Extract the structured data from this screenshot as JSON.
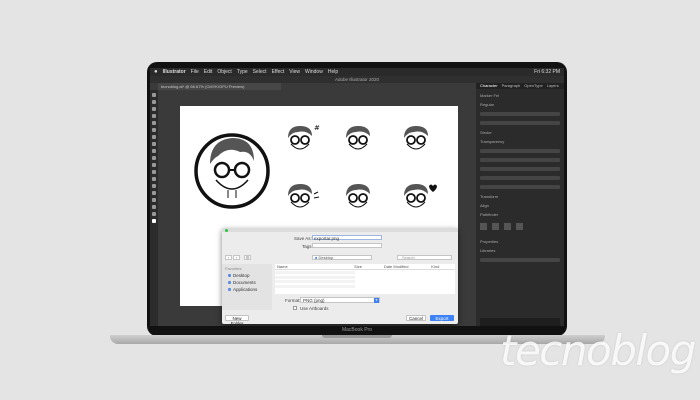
{
  "menubar": {
    "app": "Illustrator",
    "items": [
      "File",
      "Edit",
      "Object",
      "Type",
      "Select",
      "Effect",
      "View",
      "Window",
      "Help"
    ],
    "clock": "Fri 6:32 PM"
  },
  "window": {
    "title": "Adobe Illustrator 2020",
    "doc_tab": "tecnoblog.ai* @ 66.67% (CMYK/GPU Preview)"
  },
  "panel": {
    "tabs": [
      "Character",
      "Paragraph",
      "OpenType",
      "Layers"
    ],
    "font": "Marker Fel",
    "style": "Regular",
    "sections": [
      "Stroke",
      "Transparency",
      "Transform",
      "Align",
      "Pathfinder",
      "Properties",
      "Libraries"
    ]
  },
  "dialog": {
    "save_as_label": "Save As:",
    "save_as_value": "exportar.png",
    "tags_label": "Tags:",
    "location": "Desktop",
    "search_placeholder": "Search",
    "sidebar_heading": "Favorites",
    "sidebar_items": [
      "Desktop",
      "Documents",
      "Applications"
    ],
    "columns": [
      "Name",
      "Size",
      "Date Modified",
      "Kind"
    ],
    "format_label": "Format:",
    "format_value": "PNG (png)",
    "use_artboards_label": "Use Artboards",
    "new_folder_label": "New Folder",
    "cancel_label": "Cancel",
    "export_label": "Export"
  },
  "device": {
    "model": "MacBook Pro"
  },
  "watermark": "tecnoblog",
  "colors": {
    "accent": "#3d82f7",
    "desk": "#e4e4e4",
    "ui_dark": "#2b2b2b"
  }
}
